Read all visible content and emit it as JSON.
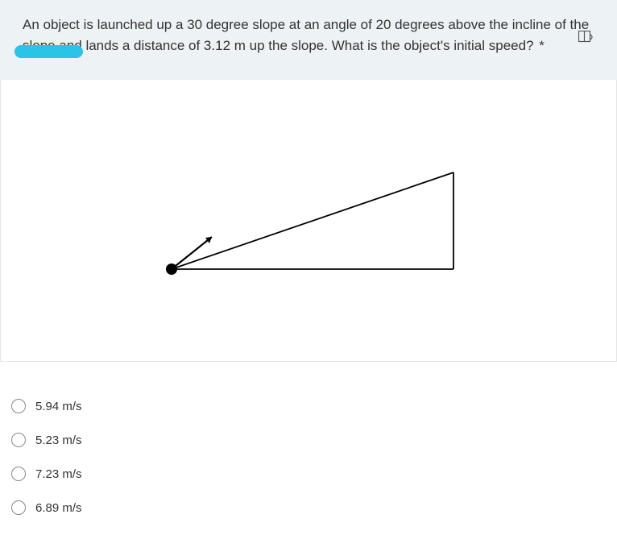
{
  "question": {
    "text": "An object is launched up a 30 degree slope at an angle of 20 degrees above the incline of the slope and lands a distance of 3.12 m up the slope.  What is the object's initial speed?",
    "required_mark": "*"
  },
  "options": [
    {
      "label": "5.94 m/s"
    },
    {
      "label": "5.23 m/s"
    },
    {
      "label": "7.23 m/s"
    },
    {
      "label": "6.89 m/s"
    }
  ]
}
